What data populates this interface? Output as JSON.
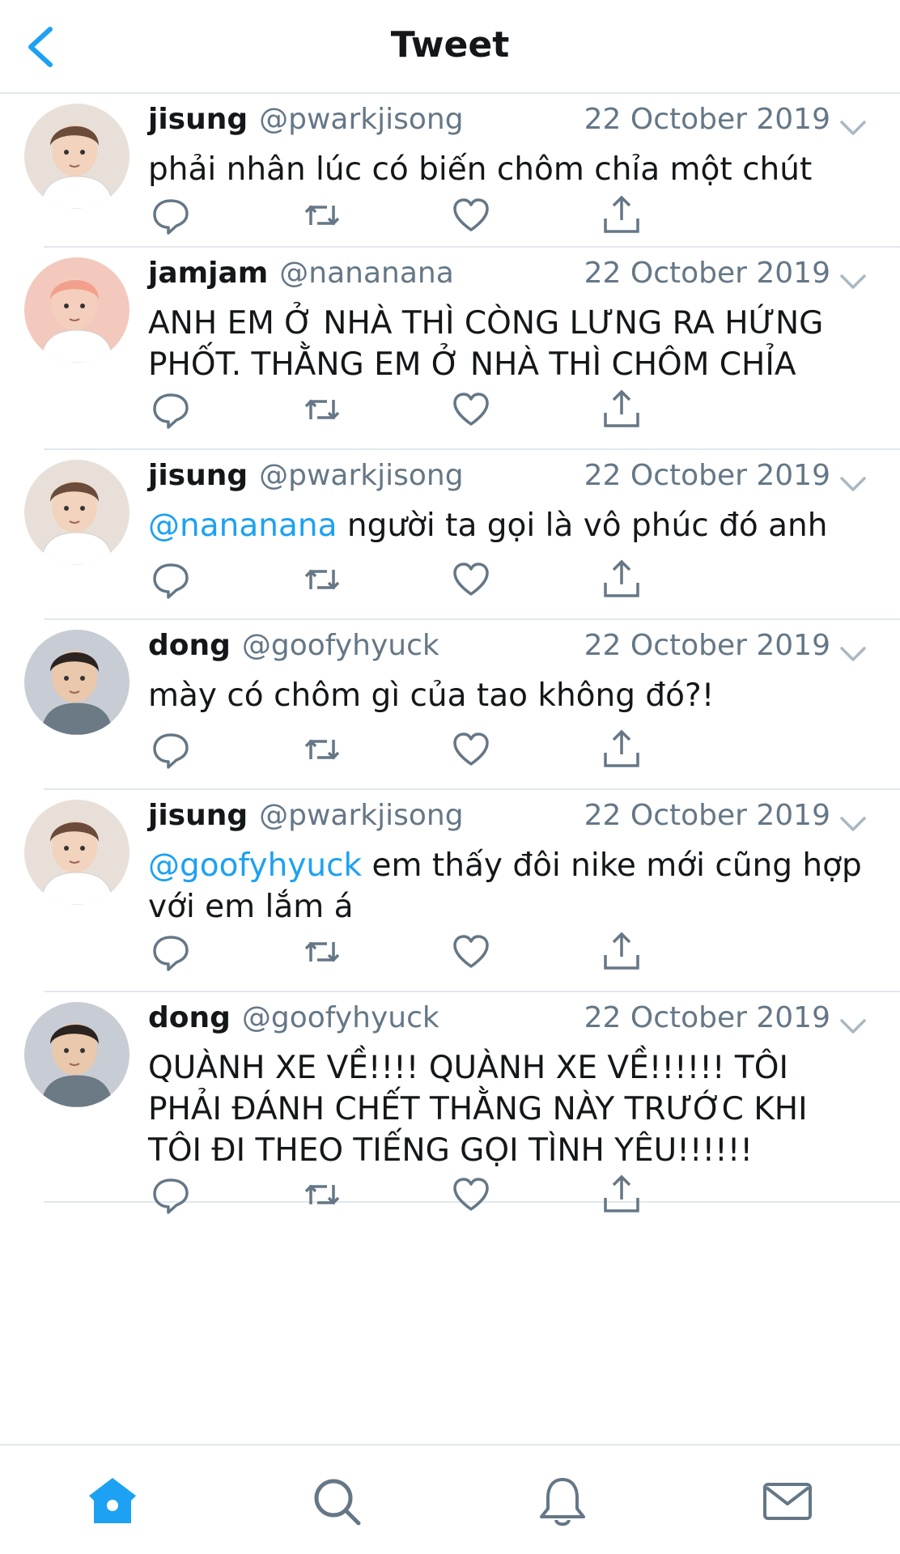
{
  "header": {
    "title": "Tweet",
    "back_icon": "chevron-left-icon"
  },
  "colors": {
    "accent": "#1da1f2",
    "text": "#14171a",
    "muted": "#657786",
    "divider": "#e1e8ed"
  },
  "tweets": [
    {
      "name": "jisung",
      "handle": "@pwarkjisong",
      "date": "22 October 2019",
      "mention": "",
      "lines": [
        "phải nhân lúc có biến chôm chỉa một chút"
      ]
    },
    {
      "name": "jamjam",
      "handle": "@nananana",
      "date": "22 October 2019",
      "mention": "",
      "lines": [
        "ANH EM Ở NHÀ THÌ CÒNG LƯNG RA HỨNG",
        "PHỐT. THẰNG EM Ở NHÀ THÌ CHÔM CHỈA"
      ]
    },
    {
      "name": "jisung",
      "handle": "@pwarkjisong",
      "date": "22 October 2019",
      "mention": "@nananana",
      "lines": [
        " người ta gọi là vô phúc đó anh"
      ]
    },
    {
      "name": "dong",
      "handle": "@goofyhyuck",
      "date": "22 October 2019",
      "mention": "",
      "lines": [
        "mày có chôm gì của tao không đó?!"
      ]
    },
    {
      "name": "jisung",
      "handle": "@pwarkjisong",
      "date": "22 October 2019",
      "mention": "@goofyhyuck",
      "lines": [
        " em thấy đôi nike mới cũng hợp",
        "với em lắm á"
      ]
    },
    {
      "name": "dong",
      "handle": "@goofyhyuck",
      "date": "22 October 2019",
      "mention": "",
      "lines": [
        "QUÀNH XE VỀ!!!! QUÀNH XE VỀ!!!!!! TÔI",
        "PHẢI ĐÁNH CHẾT THẰNG NÀY TRƯỚC KHI",
        "TÔI ĐI THEO TIẾNG GỌI TÌNH YÊU!!!!!!"
      ]
    }
  ],
  "actions": [
    "reply-icon",
    "retweet-icon",
    "like-icon",
    "share-icon"
  ],
  "bottom_nav": [
    "home-icon",
    "search-icon",
    "notifications-icon",
    "messages-icon"
  ]
}
